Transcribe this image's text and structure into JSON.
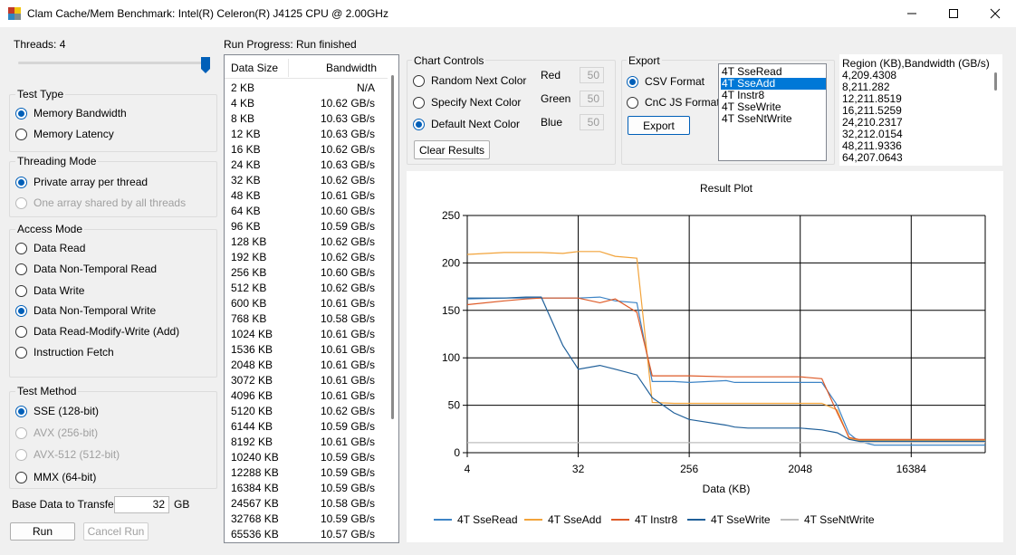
{
  "window": {
    "title": "Clam Cache/Mem Benchmark: Intel(R) Celeron(R) J4125 CPU @ 2.00GHz"
  },
  "threads": {
    "label": "Threads: 4",
    "slider_value": 4,
    "slider_max": 4
  },
  "test_type": {
    "title": "Test Type",
    "options": [
      {
        "label": "Memory Bandwidth",
        "checked": true
      },
      {
        "label": "Memory Latency",
        "checked": false
      }
    ]
  },
  "threading_mode": {
    "title": "Threading Mode",
    "options": [
      {
        "label": "Private array per thread",
        "checked": true
      },
      {
        "label": "One array shared by all threads",
        "checked": false,
        "disabled": true
      }
    ]
  },
  "access_mode": {
    "title": "Access Mode",
    "options": [
      {
        "label": "Data Read",
        "checked": false
      },
      {
        "label": "Data Non-Temporal Read",
        "checked": false
      },
      {
        "label": "Data Write",
        "checked": false
      },
      {
        "label": "Data Non-Temporal Write",
        "checked": true
      },
      {
        "label": "Data Read-Modify-Write (Add)",
        "checked": false
      },
      {
        "label": "Instruction Fetch",
        "checked": false
      }
    ]
  },
  "test_method": {
    "title": "Test Method",
    "options": [
      {
        "label": "SSE (128-bit)",
        "checked": true
      },
      {
        "label": "AVX (256-bit)",
        "checked": false,
        "disabled": true
      },
      {
        "label": "AVX-512 (512-bit)",
        "checked": false,
        "disabled": true
      },
      {
        "label": "MMX (64-bit)",
        "checked": false
      }
    ]
  },
  "base_data": {
    "label": "Base Data to Transfer:",
    "value": "32",
    "unit": "GB"
  },
  "buttons": {
    "run": "Run",
    "cancel": "Cancel Run",
    "clear": "Clear Results",
    "export": "Export"
  },
  "progress": {
    "label": "Run Progress:",
    "status": "Run finished",
    "col_size": "Data Size",
    "col_bw": "Bandwidth",
    "rows": [
      [
        "2 KB",
        "N/A"
      ],
      [
        "4 KB",
        "10.62 GB/s"
      ],
      [
        "8 KB",
        "10.63 GB/s"
      ],
      [
        "12 KB",
        "10.63 GB/s"
      ],
      [
        "16 KB",
        "10.62 GB/s"
      ],
      [
        "24 KB",
        "10.63 GB/s"
      ],
      [
        "32 KB",
        "10.62 GB/s"
      ],
      [
        "48 KB",
        "10.61 GB/s"
      ],
      [
        "64 KB",
        "10.60 GB/s"
      ],
      [
        "96 KB",
        "10.59 GB/s"
      ],
      [
        "128 KB",
        "10.62 GB/s"
      ],
      [
        "192 KB",
        "10.62 GB/s"
      ],
      [
        "256 KB",
        "10.60 GB/s"
      ],
      [
        "512 KB",
        "10.62 GB/s"
      ],
      [
        "600 KB",
        "10.61 GB/s"
      ],
      [
        "768 KB",
        "10.58 GB/s"
      ],
      [
        "1024 KB",
        "10.61 GB/s"
      ],
      [
        "1536 KB",
        "10.61 GB/s"
      ],
      [
        "2048 KB",
        "10.61 GB/s"
      ],
      [
        "3072 KB",
        "10.61 GB/s"
      ],
      [
        "4096 KB",
        "10.61 GB/s"
      ],
      [
        "5120 KB",
        "10.62 GB/s"
      ],
      [
        "6144 KB",
        "10.59 GB/s"
      ],
      [
        "8192 KB",
        "10.61 GB/s"
      ],
      [
        "10240 KB",
        "10.59 GB/s"
      ],
      [
        "12288 KB",
        "10.59 GB/s"
      ],
      [
        "16384 KB",
        "10.59 GB/s"
      ],
      [
        "24567 KB",
        "10.58 GB/s"
      ],
      [
        "32768 KB",
        "10.59 GB/s"
      ],
      [
        "65536 KB",
        "10.57 GB/s"
      ]
    ]
  },
  "chart_controls": {
    "title": "Chart Controls",
    "options": [
      {
        "label": "Random Next Color",
        "checked": false
      },
      {
        "label": "Specify Next Color",
        "checked": false
      },
      {
        "label": "Default Next Color",
        "checked": true
      }
    ],
    "red_label": "Red",
    "red": "50",
    "green_label": "Green",
    "green": "50",
    "blue_label": "Blue",
    "blue": "50"
  },
  "export": {
    "title": "Export",
    "options": [
      {
        "label": "CSV Format",
        "checked": true
      },
      {
        "label": "CnC JS Format",
        "checked": false
      }
    ],
    "series_list": [
      "4T SseRead",
      "4T SseAdd",
      "4T Instr8",
      "4T SseWrite",
      "4T SseNtWrite"
    ],
    "selected": 1,
    "csv_lines": [
      "Region (KB),Bandwidth (GB/s)",
      "4,209.4308",
      "8,211.282",
      "12,211.8519",
      "16,211.5259",
      "24,210.2317",
      "32,212.0154",
      "48,211.9336",
      "64,207.0643"
    ]
  },
  "chart_data": {
    "type": "line",
    "title": "Result Plot",
    "xlabel": "Data (KB)",
    "ylabel": "",
    "x_scale": "log2",
    "xlim": [
      4,
      65536
    ],
    "ylim": [
      0,
      250
    ],
    "x_ticks": [
      "4",
      "32",
      "256",
      "2048",
      "16384",
      "131072",
      "1048576"
    ],
    "y_ticks": [
      0,
      50,
      100,
      150,
      200,
      250
    ],
    "grid": true,
    "legend": "bottom",
    "x": [
      4,
      8,
      12,
      16,
      24,
      32,
      48,
      64,
      96,
      128,
      192,
      256,
      512,
      600,
      768,
      1024,
      1536,
      2048,
      3072,
      4096,
      5120,
      6144,
      8192,
      10240,
      12288,
      16384,
      24567,
      32768,
      65536
    ],
    "series": [
      {
        "name": "4T SseRead",
        "color": "#3d84c6",
        "values": [
          162,
          163,
          163,
          163,
          163,
          163,
          164,
          160,
          158,
          75,
          75,
          74,
          76,
          74,
          74,
          74,
          74,
          74,
          74,
          50,
          20,
          12,
          8,
          8,
          8,
          8,
          8,
          8,
          8
        ]
      },
      {
        "name": "4T SseAdd",
        "color": "#f2a33a",
        "values": [
          209,
          211,
          211,
          211,
          210,
          212,
          212,
          207,
          205,
          53,
          52,
          52,
          52,
          52,
          52,
          52,
          52,
          52,
          52,
          45,
          15,
          13,
          13,
          13,
          13,
          13,
          13,
          13,
          13
        ]
      },
      {
        "name": "4T Instr8",
        "color": "#de5a27",
        "values": [
          156,
          160,
          162,
          163,
          163,
          163,
          158,
          162,
          148,
          81,
          81,
          81,
          80,
          80,
          80,
          80,
          80,
          80,
          78,
          42,
          16,
          14,
          14,
          14,
          14,
          14,
          14,
          14,
          14
        ]
      },
      {
        "name": "4T SseWrite",
        "color": "#1f5f99",
        "values": [
          163,
          163,
          164,
          164,
          113,
          88,
          92,
          88,
          82,
          58,
          42,
          35,
          29,
          27,
          26,
          26,
          26,
          26,
          24,
          21,
          14,
          12,
          12,
          12,
          12,
          12,
          12,
          12,
          12
        ]
      },
      {
        "name": "4T SseNtWrite",
        "color": "#bdbdbd",
        "values": [
          10.6,
          10.6,
          10.6,
          10.6,
          10.6,
          10.6,
          10.6,
          10.6,
          10.6,
          10.6,
          10.6,
          10.6,
          10.6,
          10.6,
          10.6,
          10.6,
          10.6,
          10.6,
          10.6,
          10.6,
          10.6,
          10.6,
          10.6,
          10.6,
          10.6,
          10.6,
          10.6,
          10.6,
          10.6
        ]
      }
    ]
  }
}
